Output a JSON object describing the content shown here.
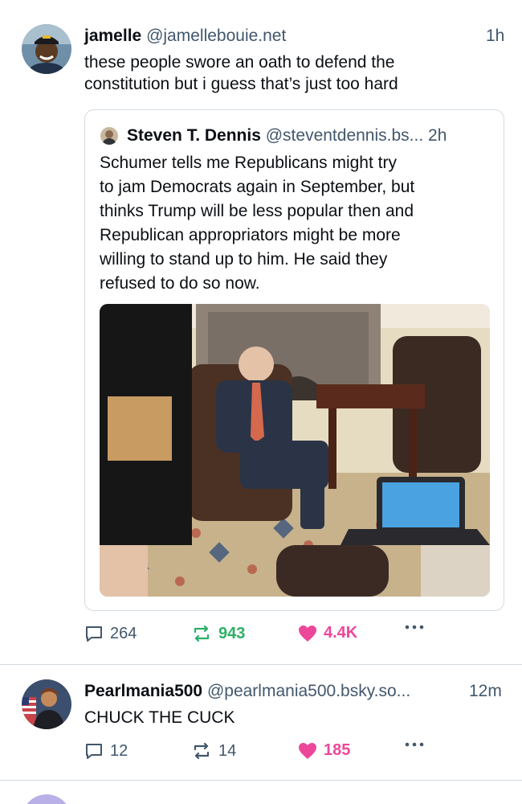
{
  "posts": [
    {
      "author_name": "jamelle",
      "author_handle": "@jamellebouie.net",
      "time": "1h",
      "text_lines": [
        "these people swore an oath to defend the",
        "constitution but i guess that’s just too hard"
      ],
      "quote": {
        "author_name": "Steven T. Dennis",
        "author_handle": "@steventdennis.bs...",
        "time": "2h",
        "text_lines": [
          "Schumer tells me Republicans might try",
          "to jam Democrats again in September, but",
          "thinks Trump will be less popular then and",
          "Republican appropriators might be more",
          "willing to stand up to him. He said they",
          "refused to do so now."
        ]
      },
      "replies": "264",
      "reposts": "943",
      "likes": "4.4K",
      "reposted": true,
      "liked": true
    },
    {
      "author_name": "Pearlmania500",
      "author_handle": "@pearlmania500.bsky.so...",
      "time": "12m",
      "text_lines": [
        "CHUCK THE CUCK"
      ],
      "replies": "12",
      "reposts": "14",
      "likes": "185",
      "reposted": false,
      "liked": true
    }
  ],
  "icons": {
    "reply": "reply-icon",
    "repost": "repost-icon",
    "like": "heart-icon",
    "more": "more-icon"
  },
  "colors": {
    "accent_repost": "#2cb067",
    "accent_like": "#ec4899",
    "muted": "#42576c",
    "border": "#d4dbe2"
  }
}
